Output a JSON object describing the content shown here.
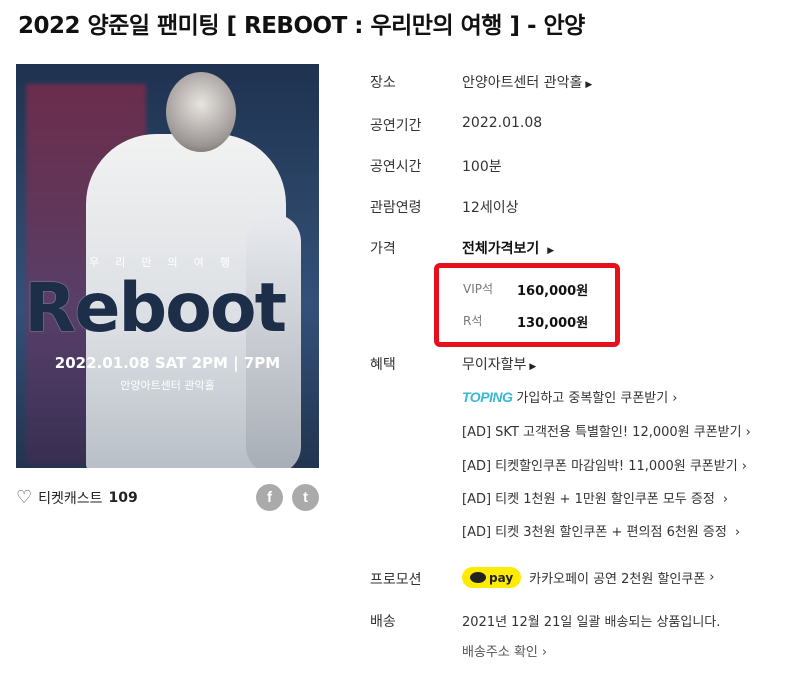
{
  "page_title": "2022 양준일 팬미팅 [ REBOOT : 우리만의 여행 ] - 안양",
  "poster": {
    "subtitle": "우리만의여행",
    "logo": "Reboot",
    "date_line": "2022.01.08 SAT 2PM | 7PM",
    "venue": "안양아트센터 관악홀"
  },
  "like": {
    "label": "티켓캐스트",
    "count": "109",
    "icon": "heart-outline-icon"
  },
  "share": {
    "facebook": "f",
    "twitter": "t"
  },
  "info": {
    "venue": {
      "label": "장소",
      "value": "안양아트센터 관악홀"
    },
    "period": {
      "label": "공연기간",
      "value": "2022.01.08"
    },
    "runtime": {
      "label": "공연시간",
      "value": "100분"
    },
    "age": {
      "label": "관람연령",
      "value": "12세이상"
    },
    "price": {
      "label": "가격",
      "link": "전체가격보기",
      "items": [
        {
          "grade": "VIP석",
          "price": "160,000원"
        },
        {
          "grade": "R석",
          "price": "130,000원"
        }
      ]
    },
    "benefit": {
      "label": "혜택",
      "value": "무이자할부",
      "toping_logo": "TOPING",
      "toping_text": "가입하고 중복할인 쿠폰받기",
      "ads": [
        "[AD] SKT 고객전용 특별할인! 12,000원 쿠폰받기",
        "[AD] 티켓할인쿠폰 마감임박! 11,000원 쿠폰받기",
        "[AD] 티켓 1천원 + 1만원 할인쿠폰 모두 증정",
        "[AD] 티켓 3천원 할인쿠폰 + 편의점 6천원 증정"
      ]
    },
    "promotion": {
      "label": "프로모션",
      "badge": "pay",
      "text": "카카오페이 공연 2천원 할인쿠폰"
    },
    "delivery": {
      "label": "배송",
      "text": "2021년 12월 21일 일괄 배송되는 상품입니다.",
      "link": "배송주소 확인"
    }
  },
  "colors": {
    "highlight_border": "#e6101c",
    "toping": "#3bb7d6",
    "kakaopay": "#ffeb00"
  }
}
